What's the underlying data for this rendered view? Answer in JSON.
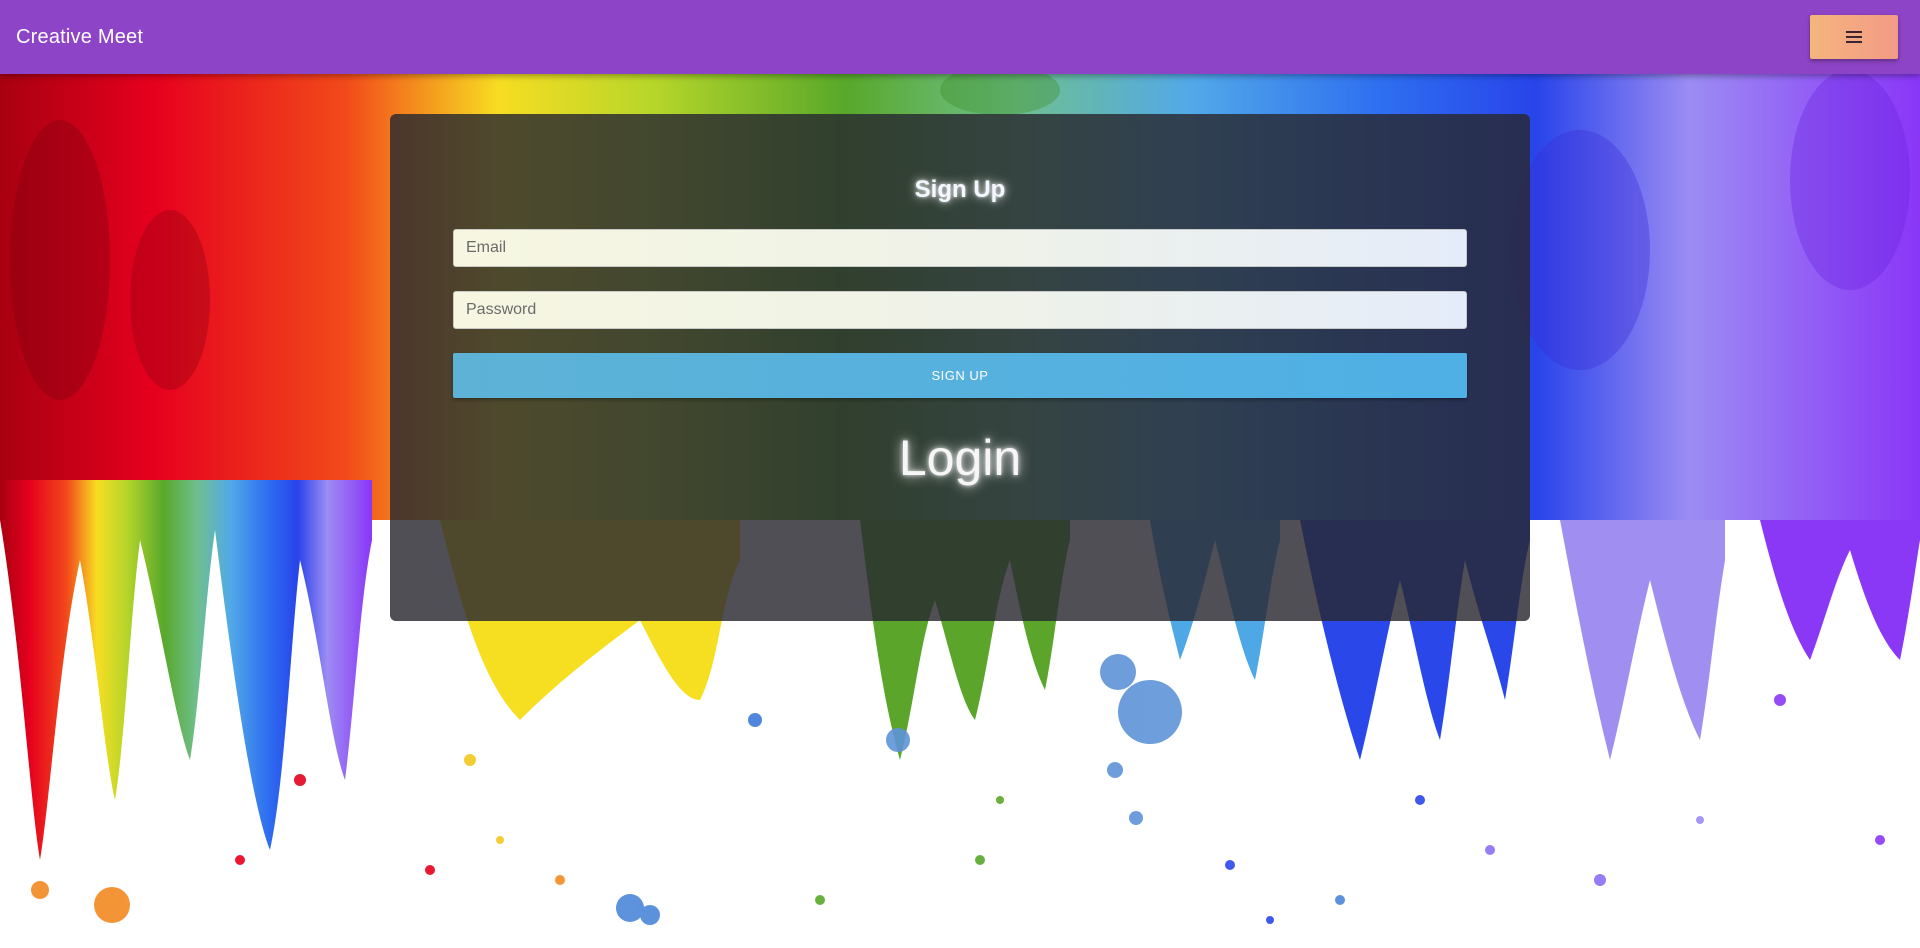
{
  "navbar": {
    "brand": "Creative Meet",
    "menu_icon": "hamburger-menu-icon",
    "menu_color_start": "#f4b57d",
    "menu_color_end": "#f39a86",
    "bar_color": "#8e44c6"
  },
  "signup": {
    "title": "Sign Up",
    "email_placeholder": "Email",
    "email_value": "",
    "password_placeholder": "Password",
    "password_value": "",
    "button_label": "SIGN UP",
    "button_color": "#52b1e0"
  },
  "login": {
    "title": "Login"
  },
  "background": {
    "description_colors": [
      "#e8001c",
      "#f7e21a",
      "#6ab427",
      "#2a5ee8",
      "#8a3bf4"
    ]
  }
}
